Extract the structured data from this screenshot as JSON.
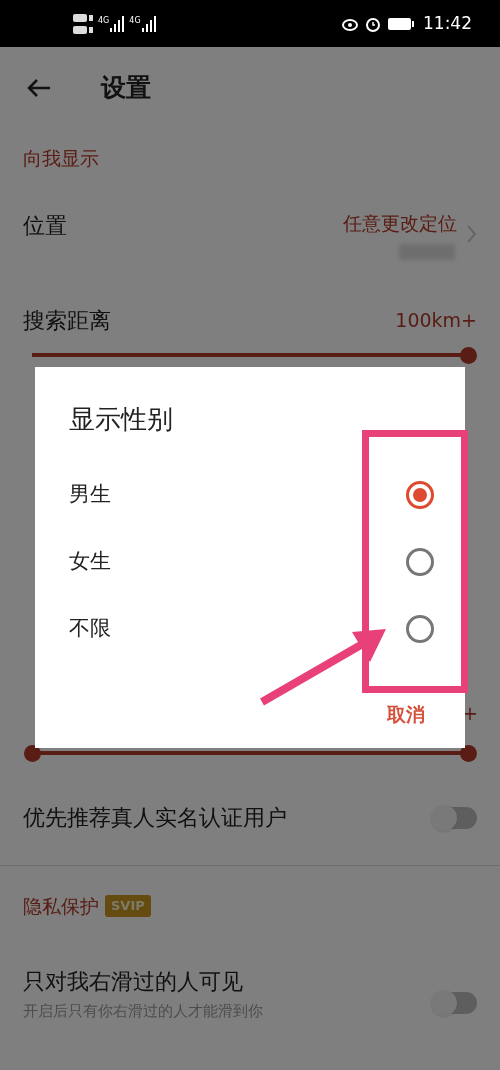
{
  "status_bar": {
    "time": "11:42",
    "network_labels": [
      "4G",
      "4G"
    ]
  },
  "header": {
    "title": "设置"
  },
  "sections": [
    {
      "title": "向我显示",
      "items": [
        {
          "kind": "link",
          "label": "位置",
          "value": "任意更改定位"
        },
        {
          "kind": "slider",
          "label": "搜索距离",
          "reading": "100km+",
          "level": 1
        }
      ]
    },
    {
      "kind": "covered",
      "items": [
        {
          "kind": "range",
          "reading": "+",
          "level": 1
        },
        {
          "kind": "toggle",
          "label": "优先推荐真人实名认证用户",
          "on": false
        }
      ]
    },
    {
      "title": "隐私保护",
      "badge": "SVIP",
      "items": [
        {
          "kind": "toggle",
          "label": "只对我右滑过的人可见",
          "subtitle": "开启后只有你右滑过的人才能滑到你",
          "on": false
        }
      ]
    }
  ],
  "dialog": {
    "title": "显示性别",
    "options": [
      {
        "label": "男生",
        "selected": true
      },
      {
        "label": "女生",
        "selected": false
      },
      {
        "label": "不限",
        "selected": false
      }
    ],
    "cancel": "取消"
  }
}
